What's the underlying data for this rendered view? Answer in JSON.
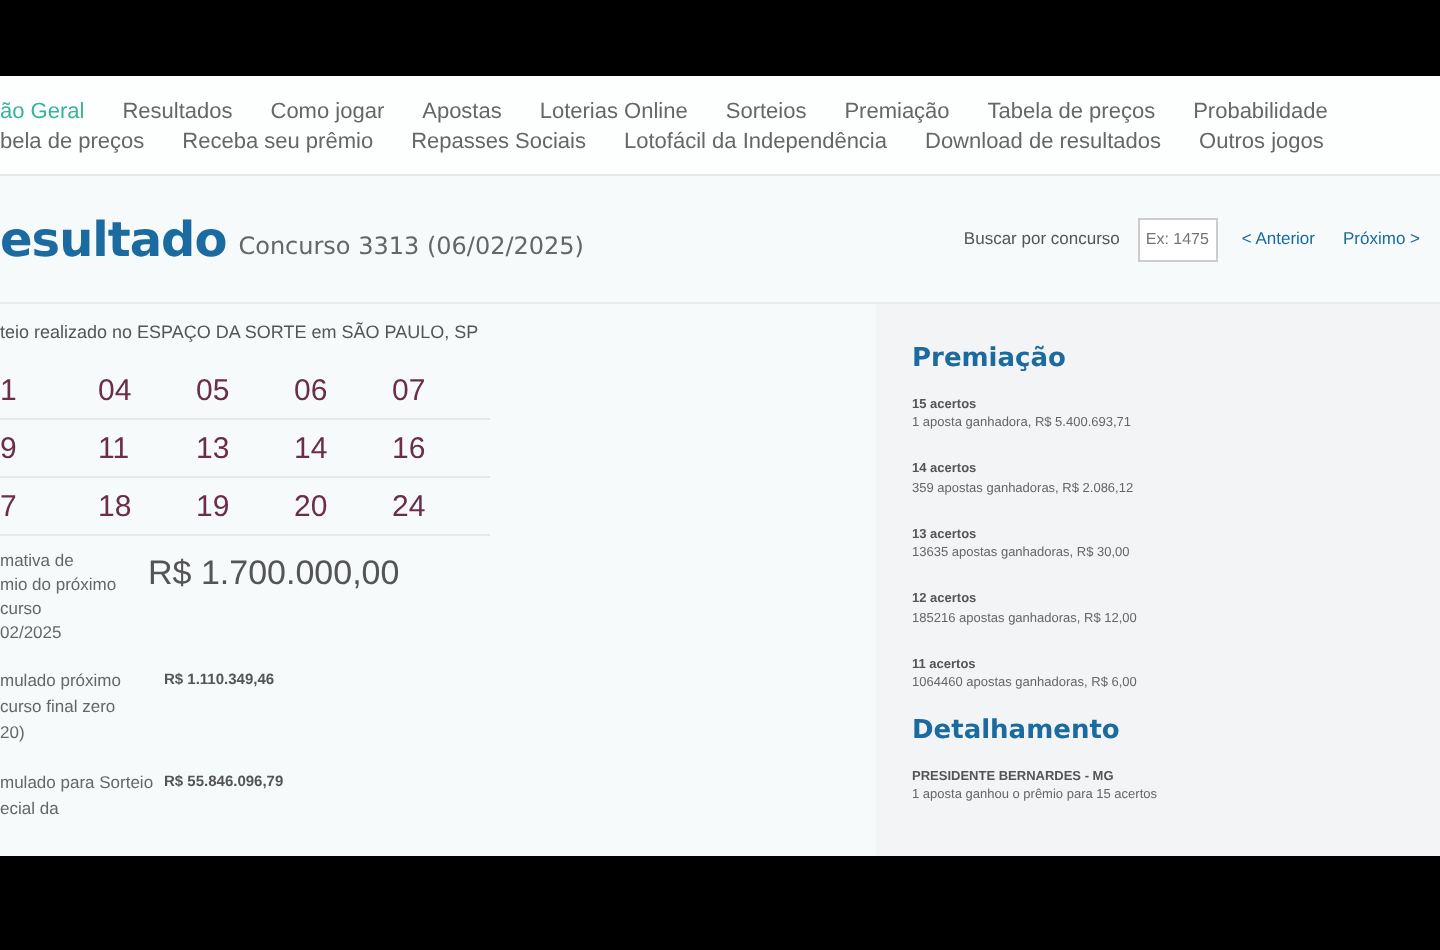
{
  "nav_rows": [
    [
      {
        "label": "ão Geral",
        "selected": true
      },
      {
        "label": "Resultados",
        "selected": false
      },
      {
        "label": "Como jogar",
        "selected": false
      },
      {
        "label": "Apostas",
        "selected": false
      },
      {
        "label": "Loterias Online",
        "selected": false
      },
      {
        "label": "Sorteios",
        "selected": false
      },
      {
        "label": "Premiação",
        "selected": false
      },
      {
        "label": "Tabela de preços",
        "selected": false
      },
      {
        "label": "Probabilidade",
        "selected": false
      }
    ],
    [
      {
        "label": "bela de preços",
        "selected": false
      },
      {
        "label": "Receba seu prêmio",
        "selected": false
      },
      {
        "label": "Repasses Sociais",
        "selected": false
      },
      {
        "label": "Lotofácil da Independência",
        "selected": false
      },
      {
        "label": "Download de resultados",
        "selected": false
      },
      {
        "label": "Outros jogos",
        "selected": false
      }
    ]
  ],
  "header": {
    "title": "esultado",
    "subtitle": "Concurso 3313 (06/02/2025)",
    "search_label": "Buscar por concurso",
    "search_placeholder": "Ex: 1475",
    "prev": "< Anterior",
    "next": "Próximo >"
  },
  "draw_place": "teio realizado no ESPAÇO DA SORTE em SÃO PAULO, SP",
  "numbers": [
    [
      "1",
      "04",
      "05",
      "06",
      "07"
    ],
    [
      "9",
      "11",
      "13",
      "14",
      "16"
    ],
    [
      "7",
      "18",
      "19",
      "20",
      "24"
    ]
  ],
  "estimate": {
    "label_lines": [
      "mativa de",
      "mio do próximo",
      "curso",
      "02/2025"
    ],
    "value": "R$ 1.700.000,00"
  },
  "accumulated": [
    {
      "label_lines": [
        "mulado próximo",
        "curso final zero",
        "20)"
      ],
      "value": "R$ 1.110.349,46"
    },
    {
      "label_lines": [
        "mulado para Sorteio",
        "ecial da"
      ],
      "value": "R$ 55.846.096,79"
    }
  ],
  "prizes": {
    "title": "Premiação",
    "tiers": [
      {
        "hits": "15 acertos",
        "detail": "1 aposta ganhadora, R$ 5.400.693,71"
      },
      {
        "hits": "14 acertos",
        "detail": "359 apostas ganhadoras, R$ 2.086,12"
      },
      {
        "hits": "13 acertos",
        "detail": "13635 apostas ganhadoras, R$ 30,00"
      },
      {
        "hits": "12 acertos",
        "detail": "185216 apostas ganhadoras, R$ 12,00"
      },
      {
        "hits": "11 acertos",
        "detail": "1064460 apostas ganhadoras, R$ 6,00"
      }
    ]
  },
  "details": {
    "title": "Detalhamento",
    "city": "PRESIDENTE BERNARDES - MG",
    "text": "1 aposta ganhou o prêmio para 15 acertos"
  }
}
